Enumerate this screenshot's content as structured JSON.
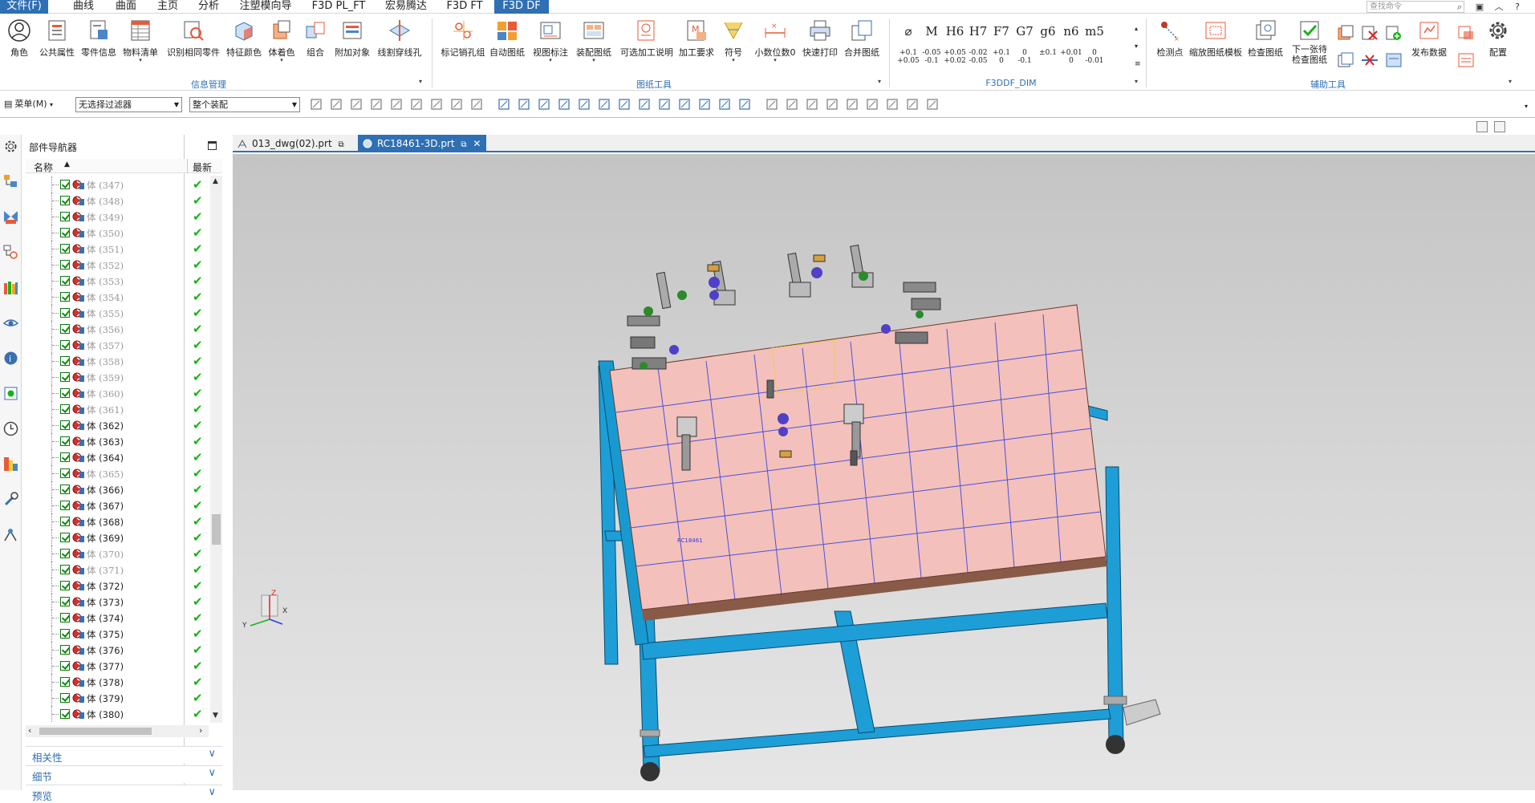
{
  "menu": {
    "tabs": [
      "文件(F)",
      "曲线",
      "曲面",
      "主页",
      "分析",
      "注塑模向导",
      "F3D PL_FT",
      "宏易腾达",
      "F3D FT",
      "F3D DF"
    ],
    "search_placeholder": "查找命令"
  },
  "ribbon": {
    "info_buttons": [
      "角色",
      "公共属性",
      "零件信息",
      "物料清单",
      "识别相同零件",
      "特征颜色",
      "体着色",
      "组合",
      "附加对象",
      "线割穿线孔"
    ],
    "info_group": "信息管理",
    "drawing_buttons": [
      "标记销孔组",
      "自动图纸",
      "视图标注",
      "装配图纸",
      "可选加工说明",
      "加工要求",
      "符号",
      "小数位数0",
      "快速打印",
      "合并图纸"
    ],
    "drawing_group": "图纸工具",
    "dims": [
      {
        "sym": "⌀",
        "sub1": "+0.1",
        "sub2": "+0.05"
      },
      {
        "sym": "M",
        "sub1": "-0.05",
        "sub2": "-0.1"
      },
      {
        "sym": "H6",
        "sub1": "+0.05",
        "sub2": "+0.02"
      },
      {
        "sym": "H7",
        "sub1": "-0.02",
        "sub2": "-0.05"
      },
      {
        "sym": "F7",
        "sub1": "+0.1",
        "sub2": "0"
      },
      {
        "sym": "G7",
        "sub1": "0",
        "sub2": "-0.1"
      },
      {
        "sym": "g6",
        "sub1": "±0.1",
        "sub2": ""
      },
      {
        "sym": "n6",
        "sub1": "+0.01",
        "sub2": "0"
      },
      {
        "sym": "m5",
        "sub1": "0",
        "sub2": "-0.01"
      }
    ],
    "dim_group": "F3DDF_DIM",
    "aux_buttons": [
      "检测点",
      "缩放图纸模板",
      "检查图纸",
      "下一张待\n检查图纸",
      "发布数据",
      "配置"
    ],
    "aux_group": "辅助工具"
  },
  "toolbar": {
    "menu_label": "菜单(M)",
    "filter_value": "无选择过滤器",
    "scope_value": "整个装配"
  },
  "navigator": {
    "title": "部件导航器",
    "col_name": "名称",
    "col_latest": "最新",
    "rows": [
      {
        "label": "体 (347)",
        "dim": true
      },
      {
        "label": "体 (348)",
        "dim": true
      },
      {
        "label": "体 (349)",
        "dim": true
      },
      {
        "label": "体 (350)",
        "dim": true
      },
      {
        "label": "体 (351)",
        "dim": true
      },
      {
        "label": "体 (352)",
        "dim": true
      },
      {
        "label": "体 (353)",
        "dim": true
      },
      {
        "label": "体 (354)",
        "dim": true
      },
      {
        "label": "体 (355)",
        "dim": true
      },
      {
        "label": "体 (356)",
        "dim": true
      },
      {
        "label": "体 (357)",
        "dim": true
      },
      {
        "label": "体 (358)",
        "dim": true
      },
      {
        "label": "体 (359)",
        "dim": true
      },
      {
        "label": "体 (360)",
        "dim": true
      },
      {
        "label": "体 (361)",
        "dim": true
      },
      {
        "label": "体 (362)",
        "dim": false
      },
      {
        "label": "体 (363)",
        "dim": false
      },
      {
        "label": "体 (364)",
        "dim": false
      },
      {
        "label": "体 (365)",
        "dim": true
      },
      {
        "label": "体 (366)",
        "dim": false
      },
      {
        "label": "体 (367)",
        "dim": false
      },
      {
        "label": "体 (368)",
        "dim": false
      },
      {
        "label": "体 (369)",
        "dim": false
      },
      {
        "label": "体 (370)",
        "dim": true
      },
      {
        "label": "体 (371)",
        "dim": true
      },
      {
        "label": "体 (372)",
        "dim": false
      },
      {
        "label": "体 (373)",
        "dim": false
      },
      {
        "label": "体 (374)",
        "dim": false
      },
      {
        "label": "体 (375)",
        "dim": false
      },
      {
        "label": "体 (376)",
        "dim": false
      },
      {
        "label": "体 (377)",
        "dim": false
      },
      {
        "label": "体 (378)",
        "dim": false
      },
      {
        "label": "体 (379)",
        "dim": false
      },
      {
        "label": "体 (380)",
        "dim": false
      }
    ],
    "sections": [
      "相关性",
      "细节",
      "预览"
    ]
  },
  "doc_tabs": [
    "013_dwg(02).prt",
    "RC18461-3D.prt"
  ],
  "viewport": {
    "plate_label": "RC18461",
    "triad_labels": [
      "X",
      "Y",
      "Z"
    ]
  },
  "colors": {
    "accent": "#2f6fb3",
    "plate": "#f4c0bc",
    "frame": "#1e9ed6",
    "check": "#19b319"
  }
}
